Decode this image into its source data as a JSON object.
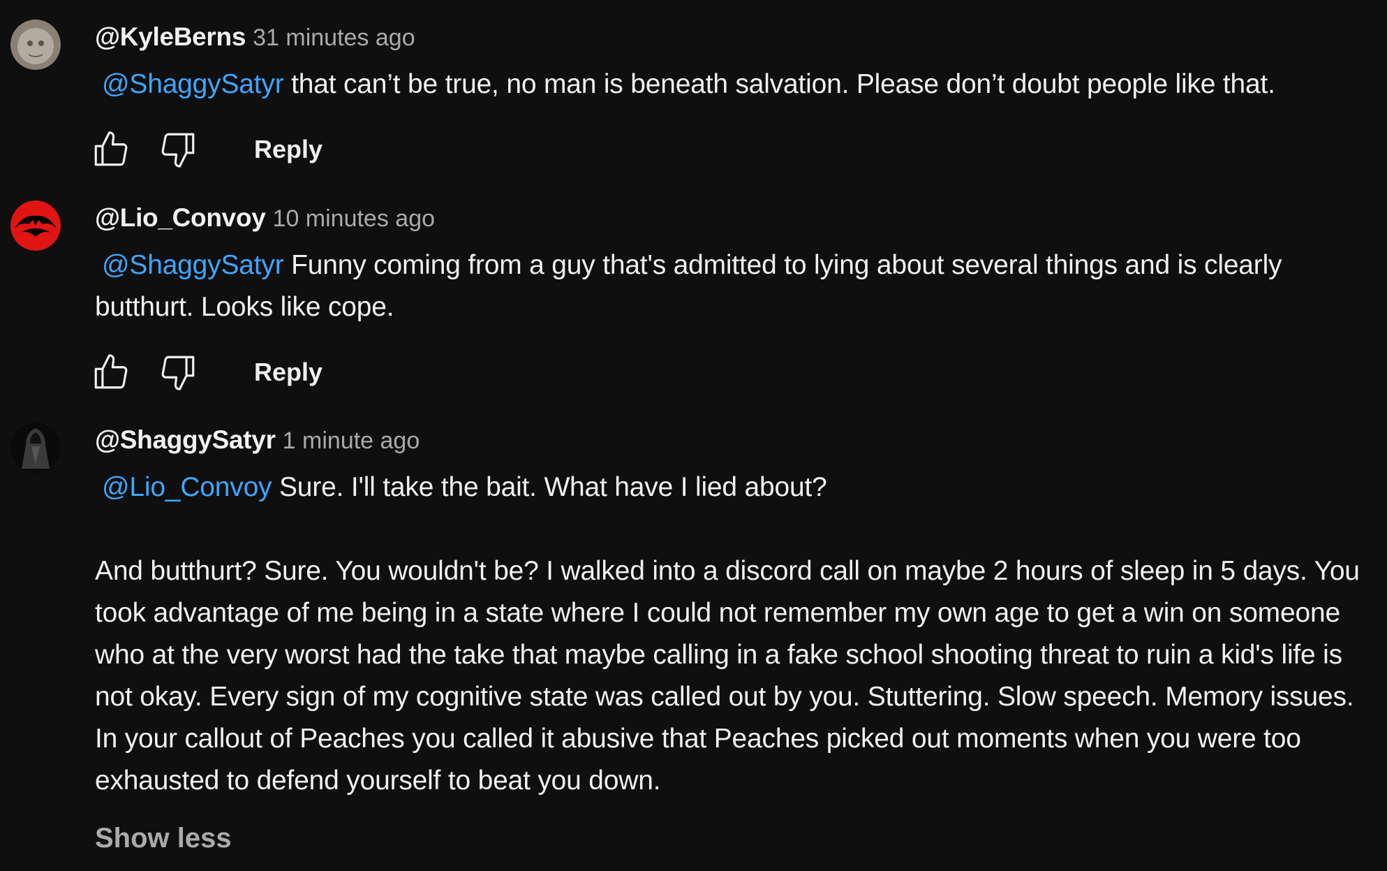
{
  "comments": [
    {
      "author": "@KyleBerns",
      "time": "31 minutes ago",
      "mention": "@ShaggySatyr",
      "text": " that can’t be true, no man is beneath salvation. Please don’t doubt people like that.",
      "reply_label": "Reply"
    },
    {
      "author": "@Lio_Convoy",
      "time": "10 minutes ago",
      "mention": "@ShaggySatyr",
      "text": "  Funny coming from a guy that's admitted to lying about several things and is clearly butthurt. Looks like cope.",
      "reply_label": "Reply"
    },
    {
      "author": "@ShaggySatyr",
      "time": "1 minute ago",
      "mention": "@Lio_Convoy",
      "text": "  Sure. I'll take the bait. What have I lied about?",
      "paragraph2": "And butthurt? Sure. You wouldn't be? I walked into a discord call on maybe 2 hours of sleep in 5 days. You took advantage of me being in a state where I could not remember my own age to get a win on someone who at the very worst had the take that maybe calling in a fake school shooting threat to ruin a kid's life is not okay. Every sign of my cognitive state was called out by you. Stuttering. Slow speech. Memory issues. In your callout of Peaches you called it abusive that Peaches picked out moments when you were too exhausted to defend yourself to beat you down.",
      "show_less_label": "Show less"
    }
  ],
  "icons": {
    "like": "thumb-up-icon",
    "dislike": "thumb-down-icon"
  },
  "colors": {
    "background": "#0f0f0f",
    "text": "#f1f1f1",
    "secondary": "#aaaaaa",
    "mention": "#3ea6ff"
  }
}
